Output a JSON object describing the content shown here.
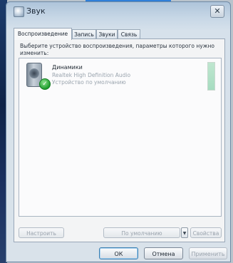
{
  "window": {
    "title": "Звук",
    "close_glyph": "✕"
  },
  "tabs": [
    {
      "label": "Воспроизведение",
      "active": true
    },
    {
      "label": "Запись",
      "active": false
    },
    {
      "label": "Звуки",
      "active": false
    },
    {
      "label": "Связь",
      "active": false
    }
  ],
  "panel": {
    "instruction": "Выберите устройство воспроизведения, параметры которого нужно изменить:",
    "devices": [
      {
        "name": "Динамики",
        "driver": "Realtek High Definition Audio",
        "status": "Устройство по умолчанию",
        "icon": "speaker-icon",
        "default_badge": "✓"
      }
    ],
    "buttons": {
      "configure": "Настроить",
      "set_default": "По умолчанию",
      "dropdown_arrow": "▼",
      "properties": "Свойства"
    }
  },
  "footer": {
    "ok": "ОК",
    "cancel": "Отмена",
    "apply": "Применить"
  },
  "colors": {
    "level_meter": "#a6dcc0",
    "default_check": "#1f9e2e"
  }
}
